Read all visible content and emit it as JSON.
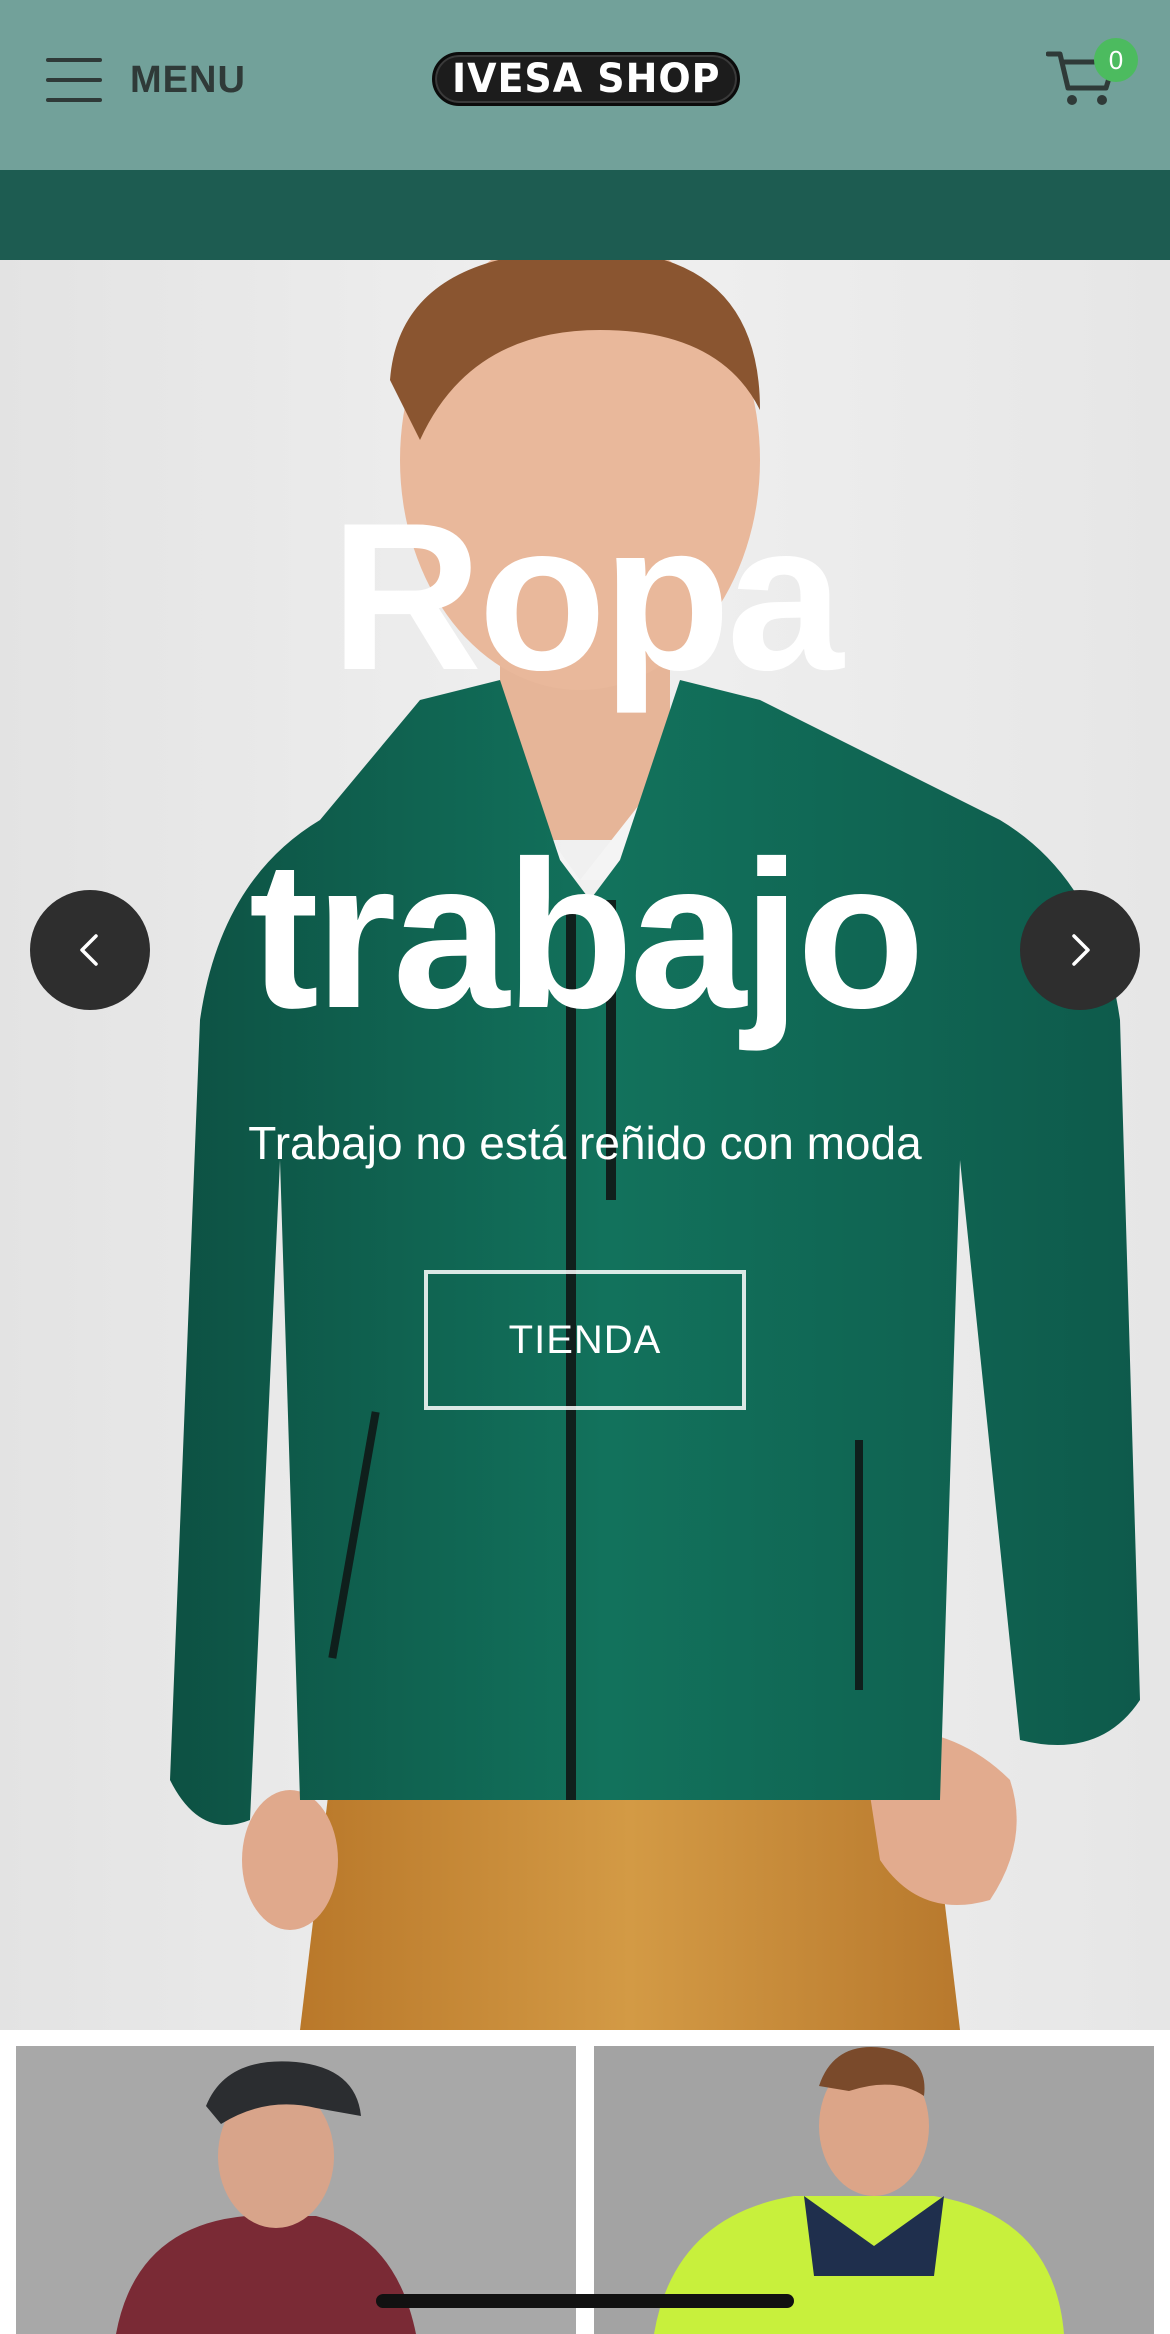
{
  "header": {
    "menu_label": "MENU",
    "logo_text": "IVESA SHOP",
    "cart_count": "0",
    "colors": {
      "background": "#72a19a",
      "badge": "#4cbb5f"
    }
  },
  "announcement_bar": {
    "text": "",
    "color": "#1d5c51"
  },
  "hero": {
    "title_line1": "Ropa",
    "title_line2": "trabajo",
    "subtitle": "Trabajo no está reñido con moda",
    "cta_label": "TIENDA",
    "prev_icon": "chevron-left-icon",
    "next_icon": "chevron-right-icon"
  },
  "categories": [
    {
      "name": "category-tile-1",
      "image": "man-in-cap-and-red-jacket"
    },
    {
      "name": "category-tile-2",
      "image": "man-in-hi-vis-jacket"
    }
  ]
}
